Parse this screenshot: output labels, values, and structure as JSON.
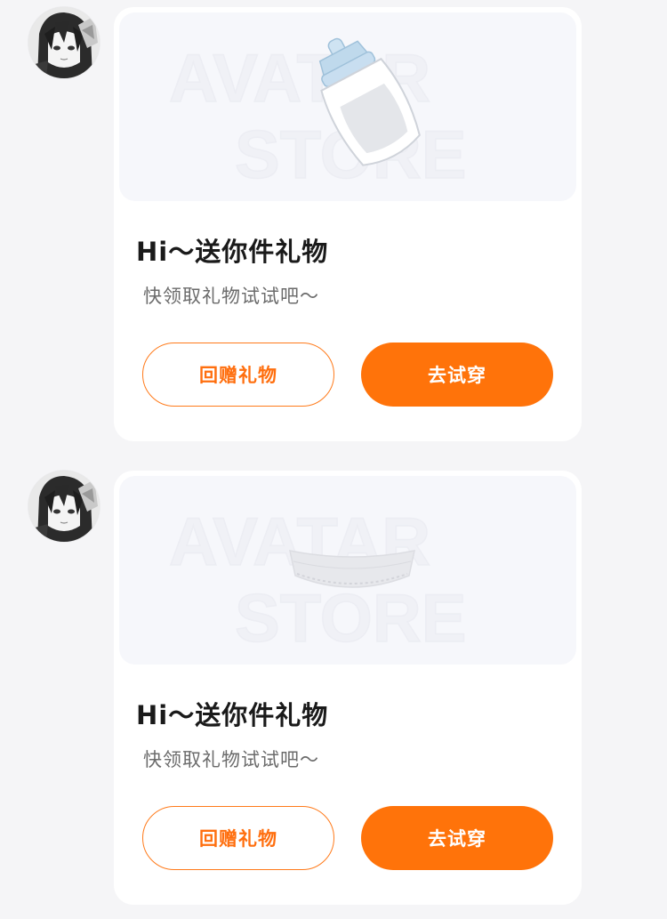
{
  "colors": {
    "accent": "#ff730a",
    "card_bg": "#ffffff",
    "page_bg": "#f5f5f7",
    "preview_bg": "#f6f7fb"
  },
  "messages": [
    {
      "avatar_icon": "anime-avatar",
      "watermark": [
        "AVATAR",
        "STORE"
      ],
      "item_icon": "baby-bottle-icon",
      "title": "Hi～送你件礼物",
      "subtitle": "快领取礼物试试吧～",
      "return_gift_label": "回赠礼物",
      "try_on_label": "去试穿"
    },
    {
      "avatar_icon": "anime-avatar",
      "watermark": [
        "AVATAR",
        "STORE"
      ],
      "item_icon": "lace-collar-icon",
      "title": "Hi～送你件礼物",
      "subtitle": "快领取礼物试试吧～",
      "return_gift_label": "回赠礼物",
      "try_on_label": "去试穿"
    }
  ]
}
